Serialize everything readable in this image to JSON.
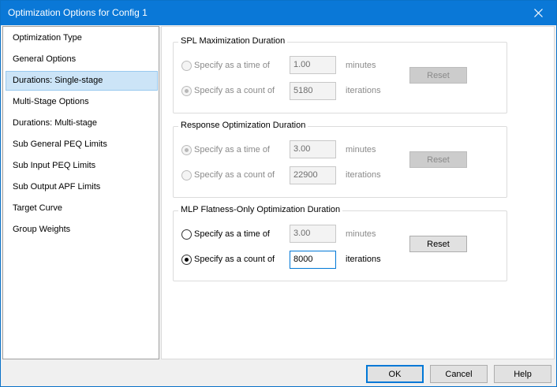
{
  "window": {
    "title": "Optimization Options for Config 1"
  },
  "nav": {
    "items": [
      {
        "label": "Optimization Type"
      },
      {
        "label": "General Options"
      },
      {
        "label": "Durations: Single-stage",
        "selected": true
      },
      {
        "label": "Multi-Stage Options"
      },
      {
        "label": "Durations: Multi-stage"
      },
      {
        "label": "Sub General PEQ Limits"
      },
      {
        "label": "Sub Input PEQ Limits"
      },
      {
        "label": "Sub Output APF Limits"
      },
      {
        "label": "Target Curve"
      },
      {
        "label": "Group Weights"
      }
    ]
  },
  "groups": [
    {
      "title": "SPL Maximization Duration",
      "enabled": false,
      "time": {
        "label": "Specify as a time of",
        "value": "1.00",
        "unit": "minutes",
        "checked": false
      },
      "count": {
        "label": "Specify as a count of",
        "value": "5180",
        "unit": "iterations",
        "checked": true
      },
      "reset_label": "Reset"
    },
    {
      "title": "Response Optimization Duration",
      "enabled": false,
      "time": {
        "label": "Specify as a time of",
        "value": "3.00",
        "unit": "minutes",
        "checked": true
      },
      "count": {
        "label": "Specify as a count of",
        "value": "22900",
        "unit": "iterations",
        "checked": false
      },
      "reset_label": "Reset"
    },
    {
      "title": "MLP Flatness-Only Optimization Duration",
      "enabled": true,
      "time": {
        "label": "Specify as a time of",
        "value": "3.00",
        "unit": "minutes",
        "checked": false
      },
      "count": {
        "label": "Specify as a count of",
        "value": "8000",
        "unit": "iterations",
        "checked": true
      },
      "reset_label": "Reset"
    }
  ],
  "footer": {
    "ok_label": "OK",
    "cancel_label": "Cancel",
    "help_label": "Help"
  },
  "colors": {
    "titlebar": "#0a78d7",
    "selection": "#cce4f7",
    "focus": "#0078d7"
  }
}
